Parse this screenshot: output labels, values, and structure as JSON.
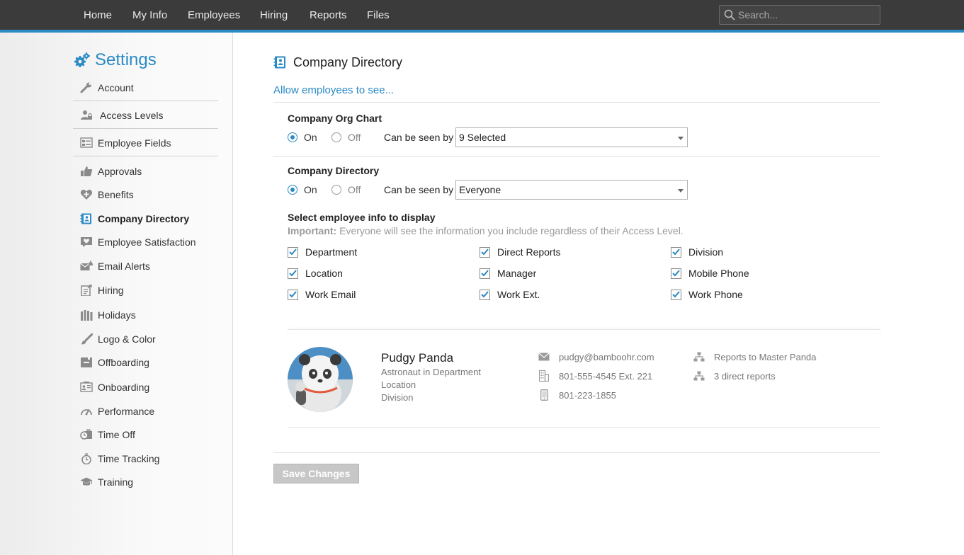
{
  "nav": {
    "items": [
      "Home",
      "My Info",
      "Employees",
      "Hiring",
      "Reports",
      "Files"
    ],
    "search_placeholder": "Search..."
  },
  "sidebar": {
    "title": "Settings",
    "items": [
      {
        "label": "Account",
        "icon": "wrench-icon"
      },
      {
        "label": "Access Levels",
        "icon": "users-lock-icon"
      },
      {
        "label": "Employee Fields",
        "icon": "fields-list-icon"
      },
      {
        "label": "Approvals",
        "icon": "thumbs-up-icon"
      },
      {
        "label": "Benefits",
        "icon": "heart-plus-icon"
      },
      {
        "label": "Company Directory",
        "icon": "directory-book-icon"
      },
      {
        "label": "Employee Satisfaction",
        "icon": "heart-chat-icon"
      },
      {
        "label": "Email Alerts",
        "icon": "mail-bell-icon"
      },
      {
        "label": "Hiring",
        "icon": "clipboard-icon"
      },
      {
        "label": "Holidays",
        "icon": "gift-icon"
      },
      {
        "label": "Logo & Color",
        "icon": "paintbrush-icon"
      },
      {
        "label": "Offboarding",
        "icon": "box-icon"
      },
      {
        "label": "Onboarding",
        "icon": "id-card-icon"
      },
      {
        "label": "Performance",
        "icon": "gauge-icon"
      },
      {
        "label": "Time Off",
        "icon": "clock-suitcase-icon"
      },
      {
        "label": "Time Tracking",
        "icon": "stopwatch-icon"
      },
      {
        "label": "Training",
        "icon": "graduation-cap-icon"
      }
    ],
    "active": "Company Directory"
  },
  "main": {
    "title": "Company Directory",
    "subtitle": "Allow employees to see...",
    "org_chart": {
      "label": "Company Org Chart",
      "on_label": "On",
      "off_label": "Off",
      "selected": "On",
      "seen_by_label": "Can be seen by",
      "seen_by_value": "9 Selected"
    },
    "directory": {
      "label": "Company Directory",
      "on_label": "On",
      "off_label": "Off",
      "selected": "On",
      "seen_by_label": "Can be seen by",
      "seen_by_value": "Everyone"
    },
    "display": {
      "label": "Select employee info to display",
      "note_strong": "Important:",
      "note_text": " Everyone will see the information you include regardless of their Access Level.",
      "fields": [
        {
          "label": "Department",
          "checked": true
        },
        {
          "label": "Direct Reports",
          "checked": true
        },
        {
          "label": "Division",
          "checked": true
        },
        {
          "label": "Location",
          "checked": true
        },
        {
          "label": "Manager",
          "checked": true
        },
        {
          "label": "Mobile Phone",
          "checked": true
        },
        {
          "label": "Work Email",
          "checked": true
        },
        {
          "label": "Work Ext.",
          "checked": true
        },
        {
          "label": "Work Phone",
          "checked": true
        }
      ]
    },
    "preview": {
      "name": "Pudgy Panda",
      "title_line": "Astronaut in Department",
      "location": "Location",
      "division": "Division",
      "email": "pudgy@bamboohr.com",
      "work_phone": "801-555-4545 Ext. 221",
      "mobile": "801-223-1855",
      "reports_to": "Reports to Master Panda",
      "direct_reports": "3 direct reports"
    },
    "save_label": "Save Changes"
  },
  "colors": {
    "accent": "#2a8ac4",
    "nav_bg": "#3b3b3b",
    "disabled_button": "#c7c7c7"
  }
}
